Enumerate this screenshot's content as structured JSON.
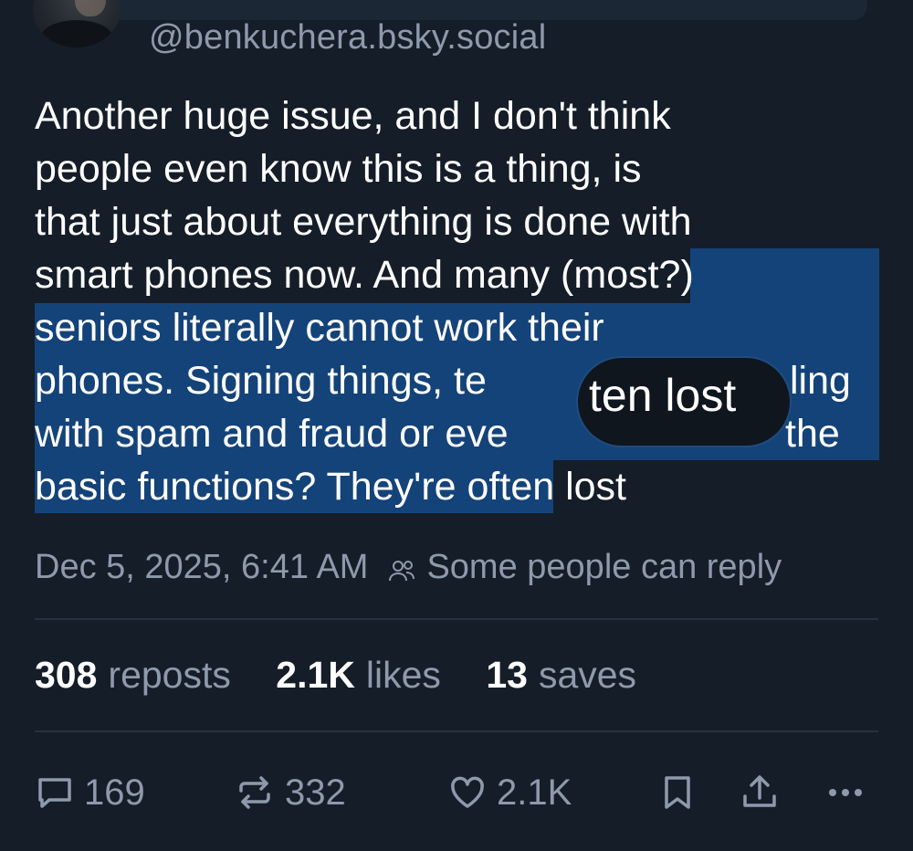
{
  "post": {
    "handle": "@benkuchera.bsky.social",
    "lines": [
      {
        "plain": "Another huge issue, and I don't think",
        "sel": "",
        "rest": ""
      },
      {
        "plain": "people even know this is a thing, is",
        "sel": "",
        "rest": ""
      },
      {
        "plain": "that just about everything is done with",
        "sel": "",
        "rest": ""
      },
      {
        "plain": "smart phones now. And many (",
        "sel": "most?)",
        "rest": ""
      },
      {
        "plain": "",
        "sel": "seniors literally cannot work their",
        "rest": ""
      },
      {
        "plain": "",
        "sel": "phones. Signing things, te",
        "rest": "ling"
      },
      {
        "plain": "",
        "sel": "with spam and fraud or eve",
        "rest": "the"
      },
      {
        "plain": "",
        "sel": "basic functions? They're",
        "rest": " often lost"
      }
    ],
    "magnifier_text": "ten lost",
    "timestamp": "Dec 5, 2025, 6:41 AM",
    "reply_setting": "Some people can reply"
  },
  "stats": {
    "reposts_count": "308",
    "reposts_label": "reposts",
    "likes_count": "2.1K",
    "likes_label": "likes",
    "saves_count": "13",
    "saves_label": "saves"
  },
  "actions": {
    "reply_count": "169",
    "repost_count": "332",
    "like_count": "2.1K",
    "bookmark_icon": "bookmark-icon",
    "share_icon": "share-icon",
    "more_icon": "more-icon"
  },
  "colors": {
    "background": "#151d28",
    "selection": "#144379",
    "muted": "#8e9aab"
  }
}
